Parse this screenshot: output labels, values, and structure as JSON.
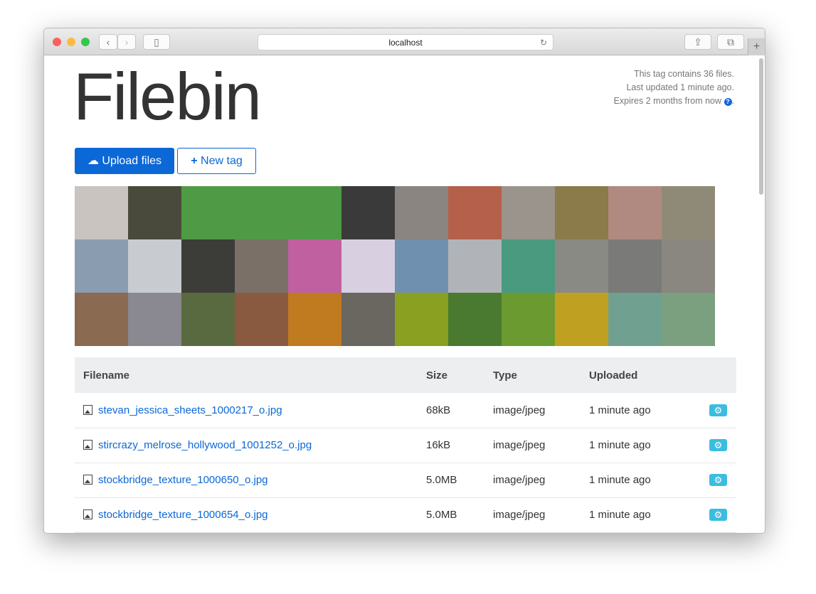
{
  "browser": {
    "url": "localhost"
  },
  "header": {
    "title": "Filebin",
    "meta": [
      "This tag contains 36 files.",
      "Last updated 1 minute ago.",
      "Expires 2 months from now"
    ],
    "meta_end": "."
  },
  "buttons": {
    "upload": "Upload files",
    "new_tag": "New tag"
  },
  "thumbnails": [
    "#c9c4bf",
    "#4a4a3c",
    "#4f9b45",
    "#4f9b45",
    "#4f9b45",
    "#3a3a3a",
    "#8a8580",
    "#b5604a",
    "#9a948c",
    "#8b7a4a",
    "#b08a80",
    "#8f8a78",
    "#8a9cb0",
    "#c8ccd0",
    "#3c3c38",
    "#7a7068",
    "#c060a0",
    "#d8d0e0",
    "#7090b0",
    "#b0b4b8",
    "#4a9a80",
    "#8a8a84",
    "#7a7a78",
    "#8a8680",
    "#8a6a50",
    "#8a8890",
    "#5a6a40",
    "#8a5a40",
    "#c07a20",
    "#6a6660",
    "#8aa020",
    "#4a7a30",
    "#6a9a30",
    "#c0a020",
    "#70a090",
    "#7aa080"
  ],
  "table": {
    "headers": [
      "Filename",
      "Size",
      "Type",
      "Uploaded"
    ],
    "rows": [
      {
        "name": "stevan_jessica_sheets_1000217_o.jpg",
        "size": "68kB",
        "type": "image/jpeg",
        "uploaded": "1 minute ago"
      },
      {
        "name": "stircrazy_melrose_hollywood_1001252_o.jpg",
        "size": "16kB",
        "type": "image/jpeg",
        "uploaded": "1 minute ago"
      },
      {
        "name": "stockbridge_texture_1000650_o.jpg",
        "size": "5.0MB",
        "type": "image/jpeg",
        "uploaded": "1 minute ago"
      },
      {
        "name": "stockbridge_texture_1000654_o.jpg",
        "size": "5.0MB",
        "type": "image/jpeg",
        "uploaded": "1 minute ago"
      }
    ]
  }
}
